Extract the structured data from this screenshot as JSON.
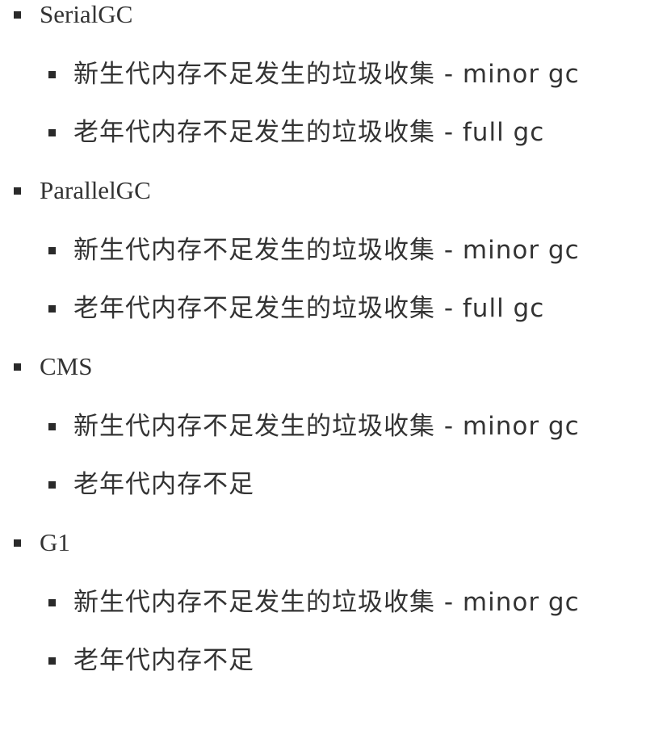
{
  "collectors": [
    {
      "name": "SerialGC",
      "items": [
        "新生代内存不足发生的垃圾收集 - minor gc",
        "老年代内存不足发生的垃圾收集 - full gc"
      ]
    },
    {
      "name": "ParallelGC",
      "items": [
        "新生代内存不足发生的垃圾收集 - minor gc",
        "老年代内存不足发生的垃圾收集 - full gc"
      ]
    },
    {
      "name": "CMS",
      "items": [
        "新生代内存不足发生的垃圾收集 - minor gc",
        "老年代内存不足"
      ]
    },
    {
      "name": "G1",
      "items": [
        "新生代内存不足发生的垃圾收集 - minor gc",
        "老年代内存不足"
      ]
    }
  ]
}
